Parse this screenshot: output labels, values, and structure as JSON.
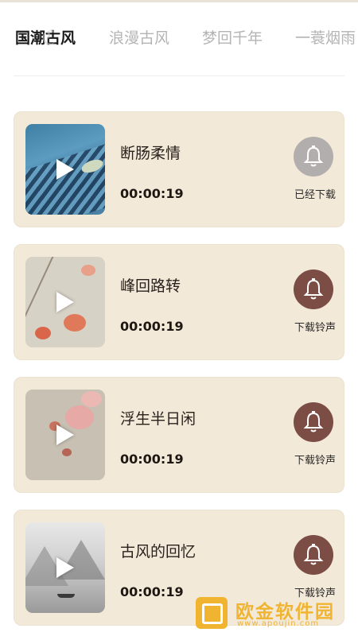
{
  "tabs": [
    {
      "label": "国潮古风",
      "active": true
    },
    {
      "label": "浪漫古风",
      "active": false
    },
    {
      "label": "梦回千年",
      "active": false
    },
    {
      "label": "一蓑烟雨",
      "active": false
    }
  ],
  "ringtones": [
    {
      "title": "断肠柔情",
      "duration": "00:00:19",
      "action": "已经下载",
      "downloaded": true,
      "button_color": "#b3aeae"
    },
    {
      "title": "峰回路转",
      "duration": "00:00:19",
      "action": "下载铃声",
      "downloaded": false,
      "button_color": "#7b4d45"
    },
    {
      "title": "浮生半日闲",
      "duration": "00:00:19",
      "action": "下载铃声",
      "downloaded": false,
      "button_color": "#7b4d45"
    },
    {
      "title": "古风的回忆",
      "duration": "00:00:19",
      "action": "下载铃声",
      "downloaded": false,
      "button_color": "#7b4d45"
    }
  ],
  "watermark": {
    "title": "欧金软件园",
    "url": "www.apoujin.com"
  },
  "colors": {
    "card_bg": "#f3e9d9",
    "active_tab": "#1a1a1a",
    "inactive_tab": "#b4b4b4",
    "watermark": "#f0b431"
  }
}
